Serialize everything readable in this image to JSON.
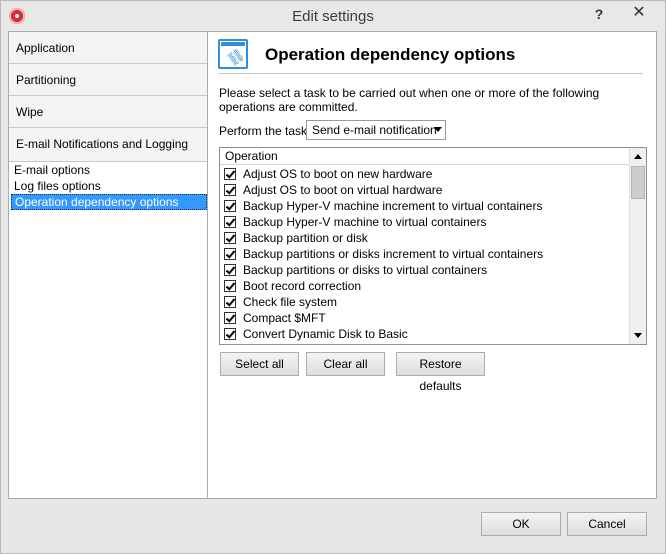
{
  "window": {
    "title": "Edit settings",
    "help_glyph": "?",
    "close_glyph": "✕"
  },
  "sidebar": {
    "categories": [
      {
        "label": "Application"
      },
      {
        "label": "Partitioning"
      },
      {
        "label": "Wipe"
      },
      {
        "label": "E-mail Notifications and Logging"
      }
    ],
    "subitems": [
      {
        "label": "E-mail options",
        "selected": false
      },
      {
        "label": "Log files options",
        "selected": false
      },
      {
        "label": "Operation dependency options",
        "selected": true
      }
    ]
  },
  "main": {
    "title": "Operation dependency options",
    "description": "Please select a task to be carried out when one or more of the following operations are committed.",
    "perform_label": "Perform the task:",
    "task_selected": "Send e-mail notification",
    "list": {
      "column_header": "Operation",
      "items": [
        {
          "label": "Adjust OS to boot on new hardware",
          "checked": true
        },
        {
          "label": "Adjust OS to boot on virtual hardware",
          "checked": true
        },
        {
          "label": "Backup Hyper-V machine increment to virtual containers",
          "checked": true
        },
        {
          "label": "Backup Hyper-V machine to virtual containers",
          "checked": true
        },
        {
          "label": "Backup partition or disk",
          "checked": true
        },
        {
          "label": "Backup partitions or disks increment to virtual containers",
          "checked": true
        },
        {
          "label": "Backup partitions or disks to virtual containers",
          "checked": true
        },
        {
          "label": "Boot record correction",
          "checked": true
        },
        {
          "label": "Check file system",
          "checked": true
        },
        {
          "label": "Compact $MFT",
          "checked": true
        },
        {
          "label": "Convert Dynamic Disk to Basic",
          "checked": true
        }
      ]
    },
    "buttons": {
      "select_all": "Select all",
      "clear_all": "Clear all",
      "restore_defaults": "Restore defaults"
    }
  },
  "footer": {
    "ok": "OK",
    "cancel": "Cancel"
  },
  "colors": {
    "selection": "#3399ff",
    "header_icon": "#2f8fd6",
    "app_icon": "#d8262c"
  }
}
